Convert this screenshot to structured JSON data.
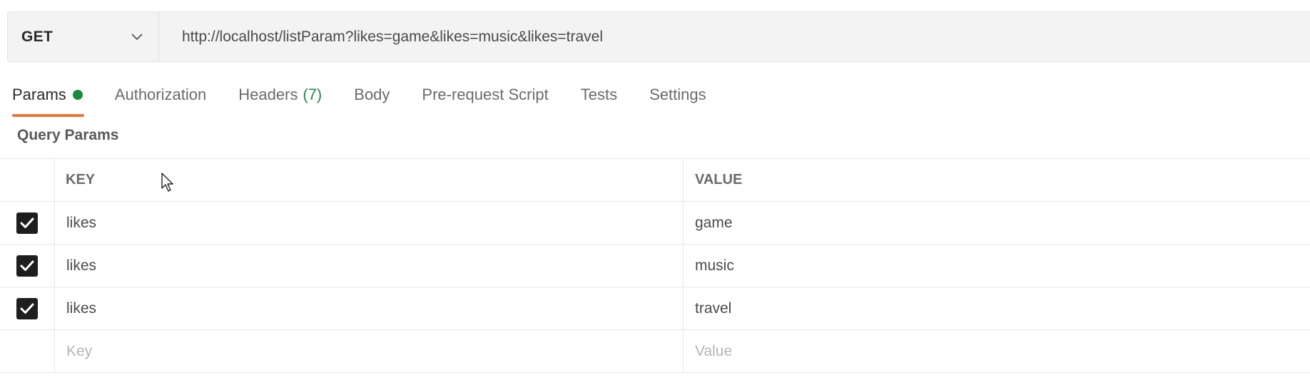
{
  "request": {
    "method": "GET",
    "url": "http://localhost/listParam?likes=game&likes=music&likes=travel"
  },
  "tabs": [
    {
      "label": "Params",
      "active": true,
      "indicator": "green-dot"
    },
    {
      "label": "Authorization"
    },
    {
      "label": "Headers",
      "count": "(7)"
    },
    {
      "label": "Body"
    },
    {
      "label": "Pre-request Script"
    },
    {
      "label": "Tests"
    },
    {
      "label": "Settings"
    }
  ],
  "query_params": {
    "section_label": "Query Params",
    "headers": {
      "key": "KEY",
      "value": "VALUE"
    },
    "rows": [
      {
        "enabled": true,
        "key": "likes",
        "value": "game"
      },
      {
        "enabled": true,
        "key": "likes",
        "value": "music"
      },
      {
        "enabled": true,
        "key": "likes",
        "value": "travel"
      }
    ],
    "new_row": {
      "key_placeholder": "Key",
      "value_placeholder": "Value"
    }
  },
  "colors": {
    "active_tab_underline": "#e8763a",
    "params_dot": "#1a8a3c",
    "headers_count": "#1d8a4f",
    "checkbox": "#1e1e1e"
  },
  "icons": {
    "method_dropdown": "chevron-down-icon",
    "checkbox": "checkmark-icon",
    "cursor": "mouse-pointer-icon"
  }
}
